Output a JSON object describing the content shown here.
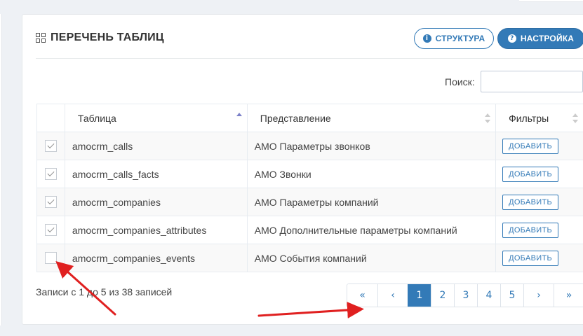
{
  "panel": {
    "title": "ПЕРЕЧЕНЬ ТАБЛИЦ",
    "structure_button": "СТРУКТУРА",
    "settings_button": "НАСТРОЙКА"
  },
  "search": {
    "label": "Поиск:",
    "value": "",
    "placeholder": ""
  },
  "table": {
    "headers": {
      "table": "Таблица",
      "view": "Представление",
      "filters": "Фильтры"
    },
    "rows": [
      {
        "checked": true,
        "table": "amocrm_calls",
        "view": "AMO Параметры звонков",
        "action": "ДОБАВИТЬ"
      },
      {
        "checked": true,
        "table": "amocrm_calls_facts",
        "view": "AMO Звонки",
        "action": "ДОБАВИТЬ"
      },
      {
        "checked": true,
        "table": "amocrm_companies",
        "view": "AMO Параметры компаний",
        "action": "ДОБАВИТЬ"
      },
      {
        "checked": true,
        "table": "amocrm_companies_attributes",
        "view": "AMO Дополнительные параметры компаний",
        "action": "ДОБАВИТЬ"
      },
      {
        "checked": false,
        "table": "amocrm_companies_events",
        "view": "AMO События компаний",
        "action": "ДОБАВИТЬ"
      }
    ]
  },
  "info": "Записи с 1 до 5 из 38 записей",
  "pagination": {
    "first": "«",
    "prev": "‹",
    "pages": [
      "1",
      "2",
      "3",
      "4",
      "5"
    ],
    "current": "1",
    "next": "›",
    "last": "»"
  },
  "colors": {
    "accent": "#337ab7",
    "annotation_arrow": "#e02020"
  }
}
